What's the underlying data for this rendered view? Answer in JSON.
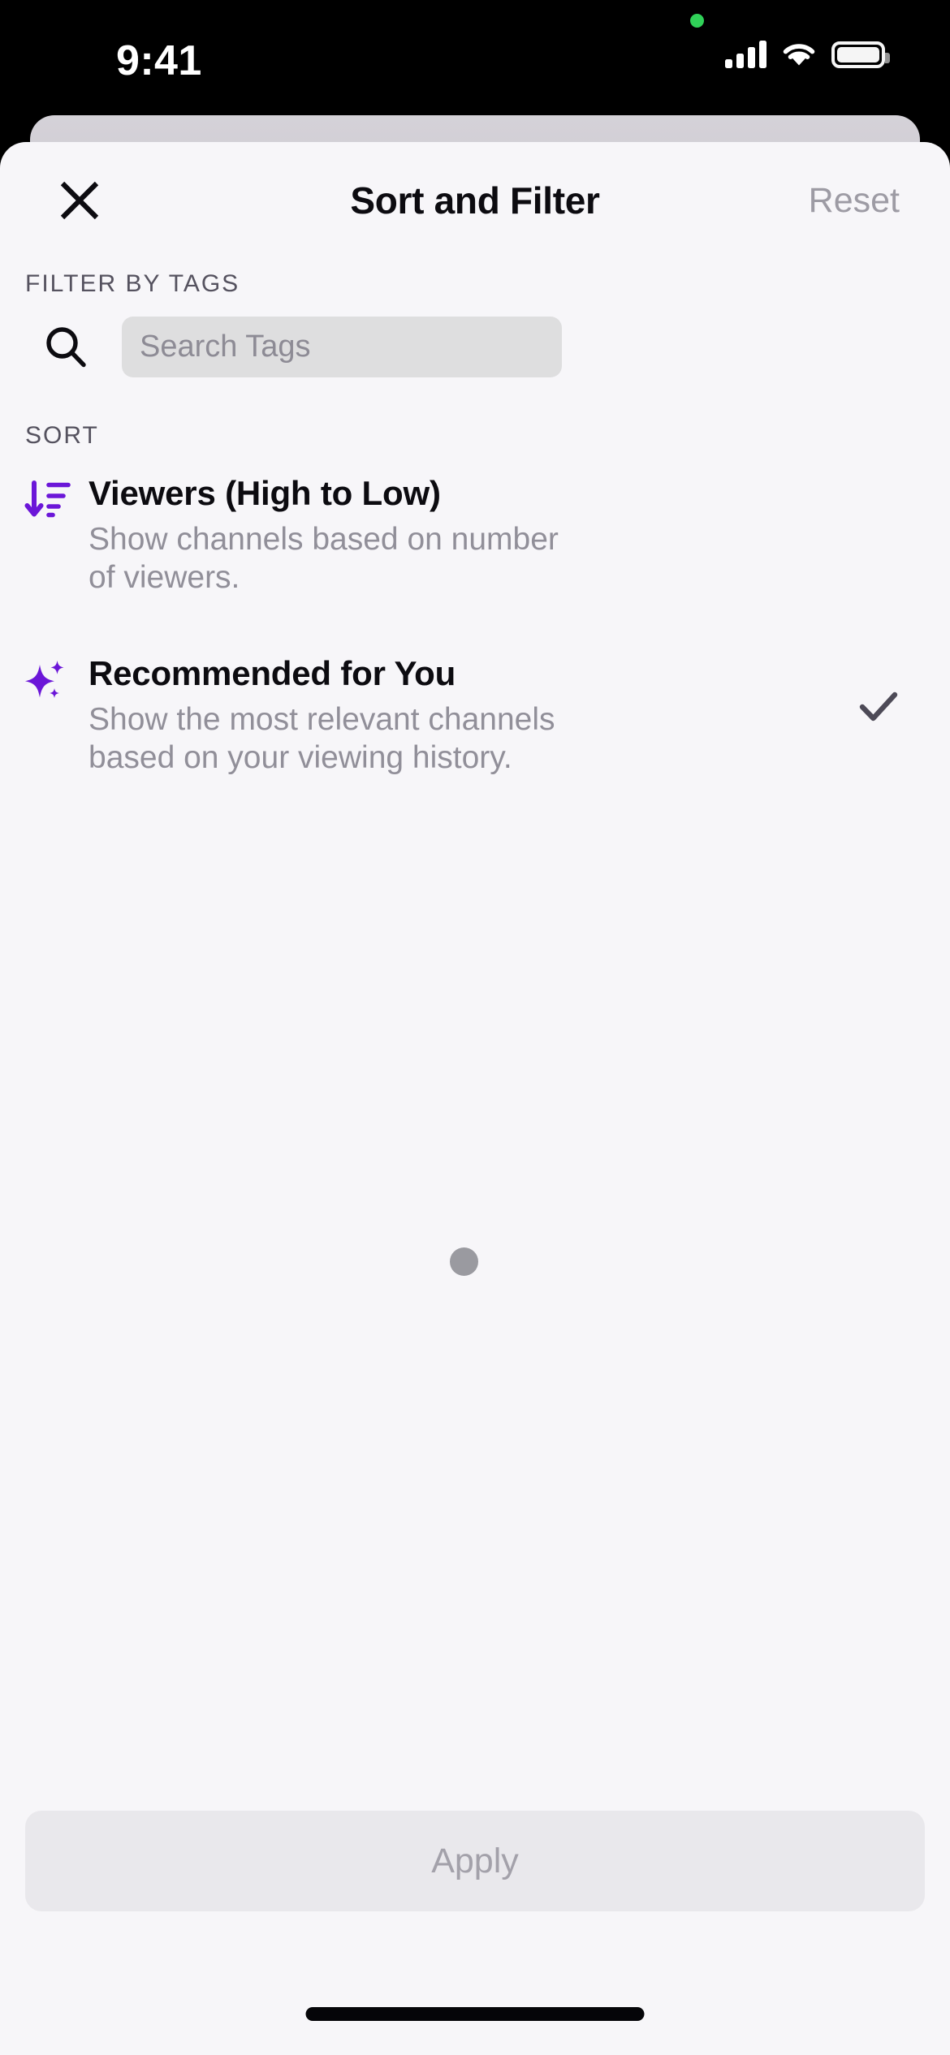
{
  "status_bar": {
    "time": "9:41",
    "icons": [
      "green-recording-dot",
      "cellular-signal-icon",
      "wifi-icon",
      "battery-icon"
    ]
  },
  "sheet": {
    "title": "Sort and Filter",
    "close_label": "close-icon",
    "reset_label": "Reset",
    "filter_section": {
      "label": "FILTER BY TAGS",
      "search": {
        "placeholder": "Search Tags",
        "value": "",
        "icon": "search-icon"
      }
    },
    "sort_section": {
      "label": "SORT",
      "options": [
        {
          "icon": "sort-descending-icon",
          "title": "Viewers (High to Low)",
          "description": "Show channels based on number of viewers.",
          "selected": false
        },
        {
          "icon": "sparkles-icon",
          "title": "Recommended for You",
          "description": "Show the most relevant channels based on your viewing history.",
          "selected": true
        }
      ]
    },
    "loading_indicator": "loading-dot",
    "apply_button": {
      "label": "Apply",
      "enabled": false
    }
  },
  "colors": {
    "accent_purple": "#6b16d8",
    "sheet_background": "#f7f6f9",
    "search_field": "#dededf",
    "apply_disabled_bg": "#e9e8ec",
    "apply_disabled_text": "#a3a1aa",
    "muted_text": "#918f99",
    "status_green": "#30d158"
  }
}
